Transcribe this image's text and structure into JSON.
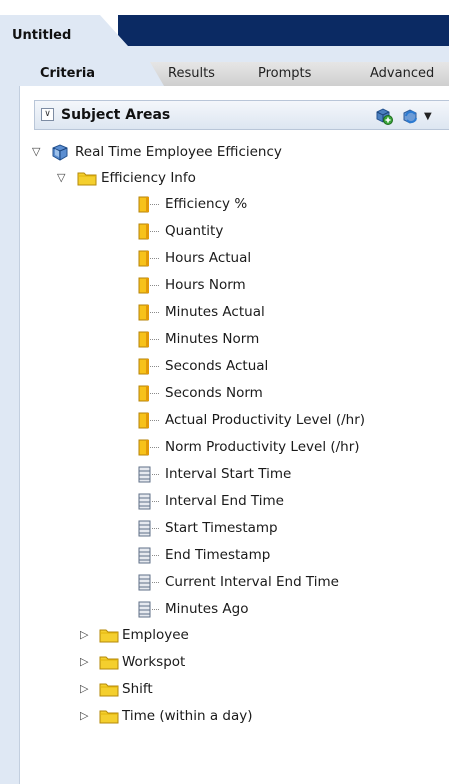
{
  "document": {
    "tab_label": "Untitled"
  },
  "tabs": [
    {
      "label": "Criteria",
      "active": true
    },
    {
      "label": "Results",
      "active": false
    },
    {
      "label": "Prompts",
      "active": false
    },
    {
      "label": "Advanced",
      "active": false
    }
  ],
  "subject_areas": {
    "title": "Subject Areas",
    "root": {
      "label": "Real Time Employee Efficiency",
      "expanded": true
    },
    "folders": [
      {
        "label": "Efficiency Info",
        "expanded": true,
        "items": [
          {
            "label": "Efficiency %",
            "kind": "measure"
          },
          {
            "label": "Quantity",
            "kind": "measure"
          },
          {
            "label": "Hours Actual",
            "kind": "measure"
          },
          {
            "label": "Hours Norm",
            "kind": "measure"
          },
          {
            "label": "Minutes Actual",
            "kind": "measure"
          },
          {
            "label": "Minutes Norm",
            "kind": "measure"
          },
          {
            "label": "Seconds Actual",
            "kind": "measure"
          },
          {
            "label": "Seconds Norm",
            "kind": "measure"
          },
          {
            "label": "Actual Productivity Level (/hr)",
            "kind": "measure"
          },
          {
            "label": "Norm Productivity Level (/hr)",
            "kind": "measure"
          },
          {
            "label": "Interval Start Time",
            "kind": "attribute"
          },
          {
            "label": "Interval End Time",
            "kind": "attribute"
          },
          {
            "label": "Start Timestamp",
            "kind": "attribute"
          },
          {
            "label": "End Timestamp",
            "kind": "attribute"
          },
          {
            "label": "Current Interval End Time",
            "kind": "attribute"
          },
          {
            "label": "Minutes Ago",
            "kind": "attribute"
          }
        ]
      },
      {
        "label": "Employee",
        "expanded": false
      },
      {
        "label": "Workspot",
        "expanded": false
      },
      {
        "label": "Shift",
        "expanded": false
      },
      {
        "label": "Time (within a day)",
        "expanded": false
      }
    ]
  },
  "colors": {
    "navy": "#0b2a63",
    "panel_bg": "#dfe8f4",
    "folder": "#f1c40f",
    "measure": "#f2b705",
    "attribute": "#7f8fa6"
  }
}
